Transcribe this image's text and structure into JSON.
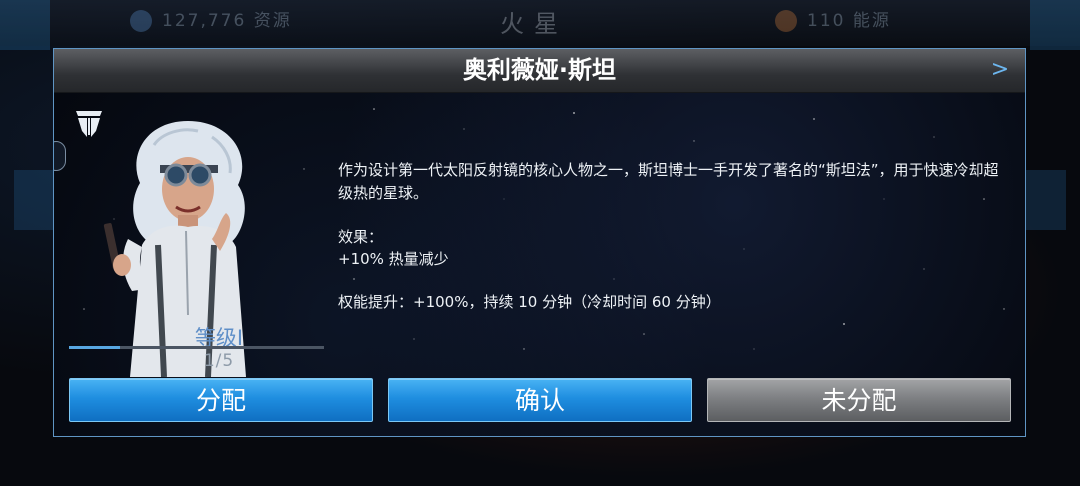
{
  "background": {
    "resource_left": "127,776 资源",
    "planet_name": "火星",
    "resource_right": "110 能源"
  },
  "dialog": {
    "title": "奥利薇娅·斯坦",
    "next_label": ">",
    "description": "作为设计第一代太阳反射镜的核心人物之一，斯坦博士一手开发了著名的“斯坦法”，用于快速冷却超级热的星球。",
    "effect_heading": "效果：",
    "effect_value": "+10% 热量减少",
    "perk_line": "权能提升：+100%，持续 10 分钟（冷却时间 60 分钟）",
    "level_label": "等级I",
    "progress_text": "1/5",
    "progress_fraction": 0.2
  },
  "buttons": {
    "assign": "分配",
    "confirm": "确认",
    "unassign": "未分配"
  },
  "colors": {
    "accent_blue": "#1f8ee0",
    "button_gray": "#7e8083",
    "frame_border": "#5f95c4"
  },
  "icons": {
    "logo": "faction-emblem-icon",
    "next": "chevron-right-icon"
  }
}
